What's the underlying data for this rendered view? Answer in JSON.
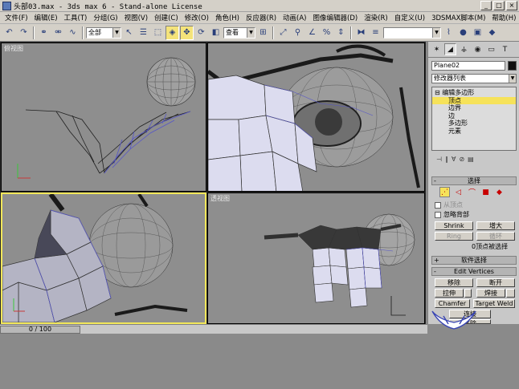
{
  "window": {
    "title": "头部03.max - 3ds max 6 - Stand-alone License",
    "buttons": [
      "_",
      "□",
      "×"
    ]
  },
  "menubar": {
    "items": [
      "文件(F)",
      "编辑(E)",
      "工具(T)",
      "分组(G)",
      "视图(V)",
      "创建(C)",
      "修改(O)",
      "角色(H)",
      "反应器(R)",
      "动画(A)",
      "图像编辑器(D)",
      "渲染(R)",
      "自定义(U)",
      "3DSMAX脚本(M)",
      "帮助(H)"
    ]
  },
  "toolbar": {
    "selection_filter": "全部",
    "reference_coord": "查看",
    "named_selection": ""
  },
  "viewports": {
    "top_left_label": "俯视图",
    "top_right_label": "",
    "bottom_left_label": "",
    "bottom_right_label": "透视图"
  },
  "command_panel": {
    "object_name": "Plane02",
    "object_color": "#101010",
    "modifier_list": "修改器列表",
    "stack": {
      "root": "编辑多边形",
      "subobjects": [
        "顶点",
        "边界",
        "边",
        "多边形",
        "元素"
      ],
      "selected": "顶点"
    },
    "selection": {
      "title": "选择",
      "by_vertex": "从顶点",
      "ignore_backfacing": "忽略背部",
      "shrink": "Shrink",
      "grow": "增大",
      "ring": "Ring",
      "loop": "循环",
      "info": "0顶点被选择"
    },
    "soft_selection": {
      "title": "软件选择"
    },
    "edit_vertices": {
      "title": "Edit Vertices",
      "remove": "移除",
      "break": "断开",
      "extrude": "拉伸",
      "weld": "焊接",
      "chamfer": "Chamfer",
      "target_weld": "Target Weld",
      "connect": "连接",
      "partial": "移除"
    }
  },
  "timeline": {
    "frame": "0 / 100"
  }
}
